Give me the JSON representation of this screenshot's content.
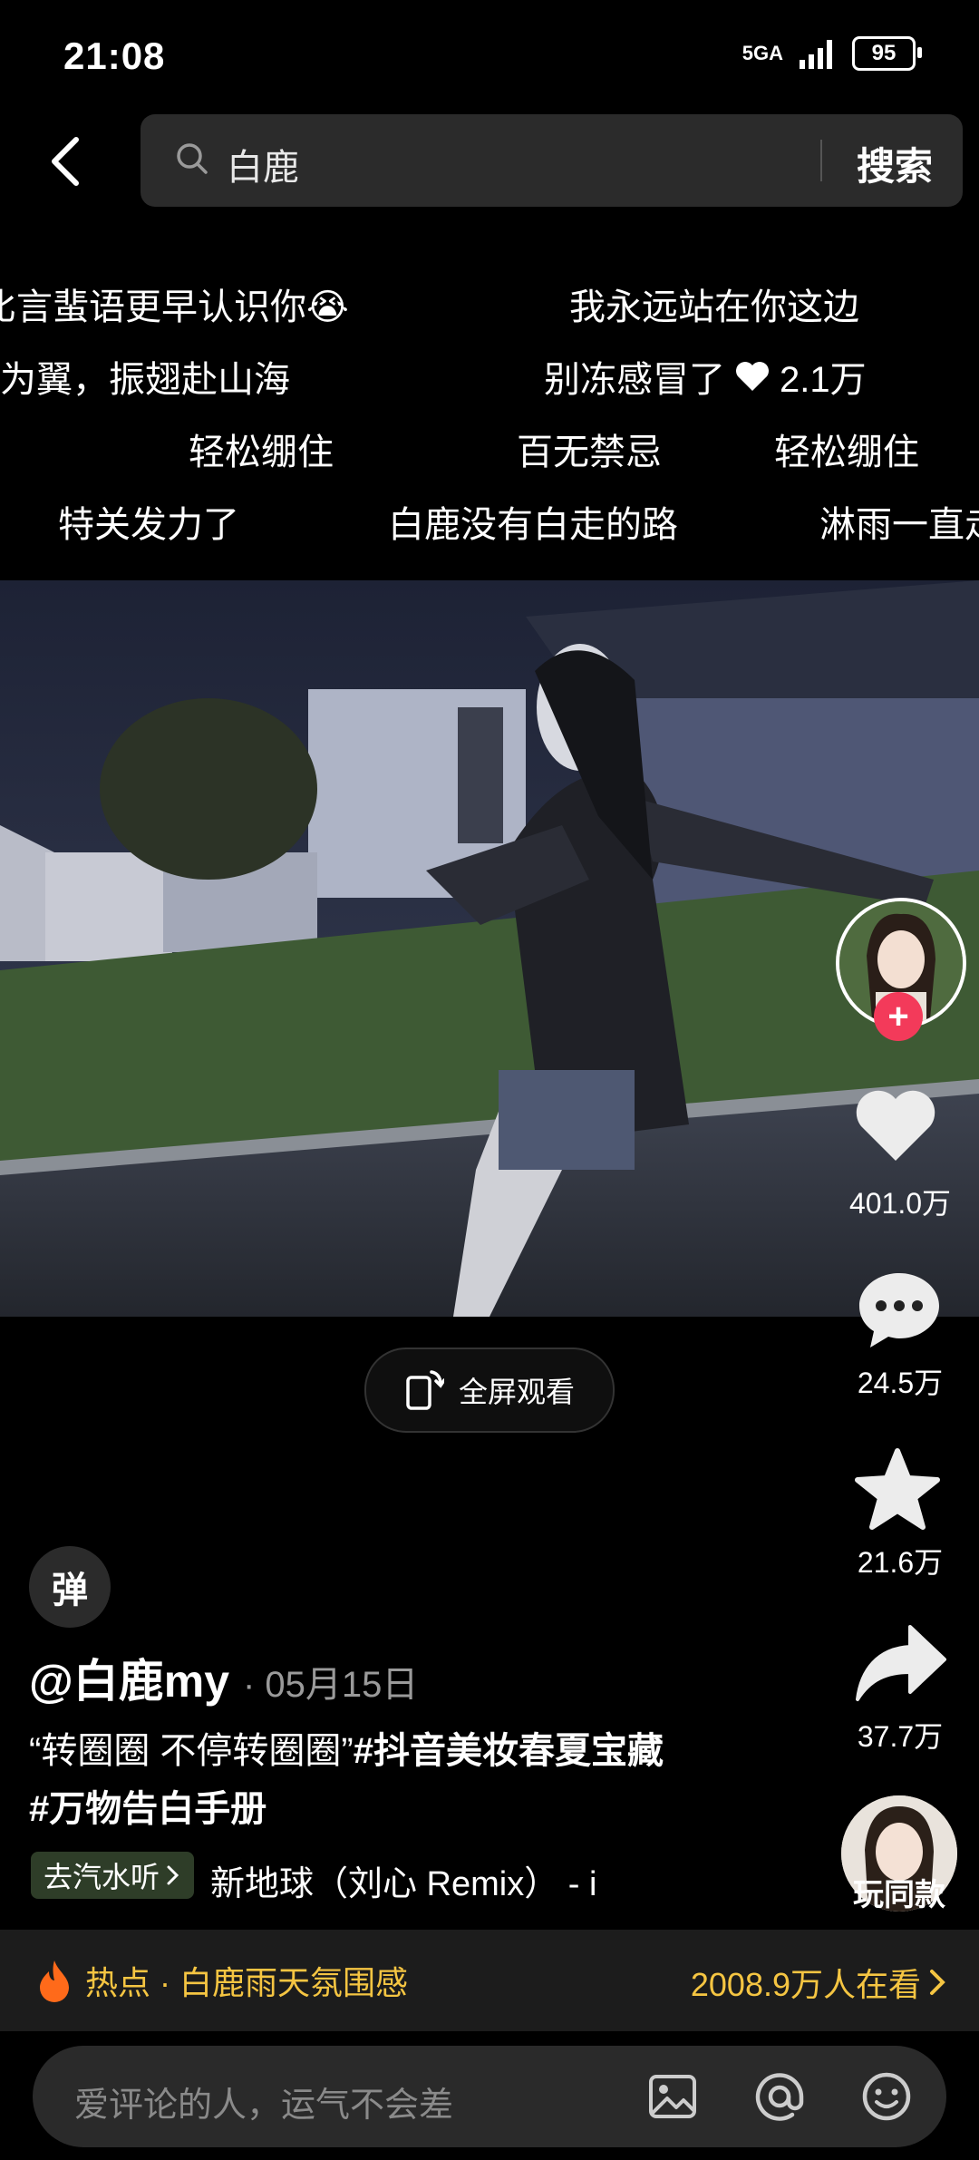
{
  "status_bar": {
    "time": "21:08",
    "network": "5GA",
    "battery": "95"
  },
  "search": {
    "query": "白鹿",
    "button_label": "搜索"
  },
  "danmaku": [
    {
      "text": "比言蜚语更早认识你😭"
    },
    {
      "text": "我永远站在你这边"
    },
    {
      "text": "为翼，振翅赴山海"
    },
    {
      "text": "别冻感冒了"
    },
    {
      "text": "2.1万"
    },
    {
      "text": "轻松绷住"
    },
    {
      "text": "百无禁忌"
    },
    {
      "text": "轻松绷住"
    },
    {
      "text": "特关发力了"
    },
    {
      "text": "白鹿没有白走的路"
    },
    {
      "text": "淋雨一直走"
    }
  ],
  "fullscreen_label": "全屏观看",
  "actions": {
    "follow_plus": "+",
    "likes": "401.0万",
    "comments": "24.5万",
    "favorites": "21.6万",
    "shares": "37.7万",
    "play_same": "玩同款"
  },
  "danmu_toggle": "弹",
  "post": {
    "author": "@白鹿my",
    "date": "· 05月15日",
    "desc_line1_quote": "“转圈圈 不停转圈圈”",
    "desc_line1_tag": "#抖音美妆春夏宝藏",
    "desc_line2_tag": "#万物告白手册",
    "music_tag": "去汽水听",
    "music_name": "新地球（刘心 Remix） - i"
  },
  "hot": {
    "label": "热点 · 白鹿雨天氛围感",
    "watching": "2008.9万人在看"
  },
  "comment": {
    "placeholder": "爱评论的人，运气不会差"
  },
  "colors": {
    "accent_yellow": "#f5c542",
    "follow_red": "#f33a5a",
    "music_tag_bg": "#2e3d28"
  }
}
